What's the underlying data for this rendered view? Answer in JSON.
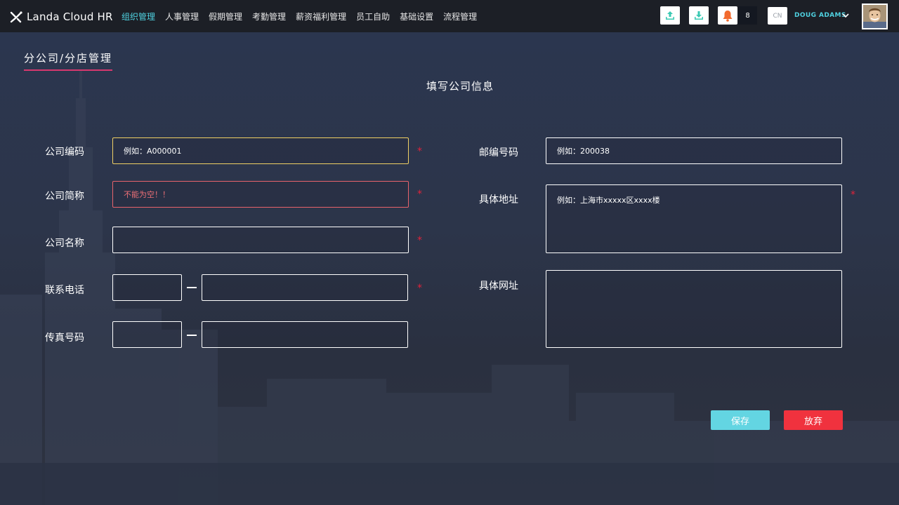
{
  "app": {
    "name": "Landa Cloud HR"
  },
  "nav": [
    {
      "label": "组织管理",
      "active": true
    },
    {
      "label": "人事管理",
      "active": false
    },
    {
      "label": "假期管理",
      "active": false
    },
    {
      "label": "考勤管理",
      "active": false
    },
    {
      "label": "薪资福利管理",
      "active": false
    },
    {
      "label": "员工自助",
      "active": false
    },
    {
      "label": "基础设置",
      "active": false
    },
    {
      "label": "流程管理",
      "active": false
    }
  ],
  "toolbar": {
    "upload_icon": "upload-icon",
    "download_icon": "download-icon",
    "bell_icon": "bell-icon",
    "notification_count": "8",
    "language": "CN",
    "user_name": "DOUG ADAMS"
  },
  "page": {
    "title": "分公司/分店管理",
    "form_title": "填写公司信息"
  },
  "form": {
    "company_code": {
      "label": "公司编码",
      "value": "例如：A000001"
    },
    "company_short": {
      "label": "公司简称",
      "value": "不能为空！！"
    },
    "company_name": {
      "label": "公司名称",
      "value": ""
    },
    "phone": {
      "label": "联系电话",
      "area": "",
      "number": ""
    },
    "fax": {
      "label": "传真号码",
      "area": "",
      "number": ""
    },
    "postcode": {
      "label": "邮编号码",
      "value": "例如：200038"
    },
    "address": {
      "label": "具体地址",
      "value": "例如：上海市xxxxx区xxxx楼"
    },
    "website": {
      "label": "具体网址",
      "value": ""
    },
    "required_mark": "*"
  },
  "buttons": {
    "save": "保存",
    "cancel": "放弃"
  },
  "colors": {
    "accent": "#4fd1e0",
    "title_underline": "#d8386f",
    "required": "#e0233b",
    "save": "#63d5e2",
    "cancel": "#f0323e",
    "bell": "#f26a2e",
    "upload_download": "#39c9b3"
  }
}
